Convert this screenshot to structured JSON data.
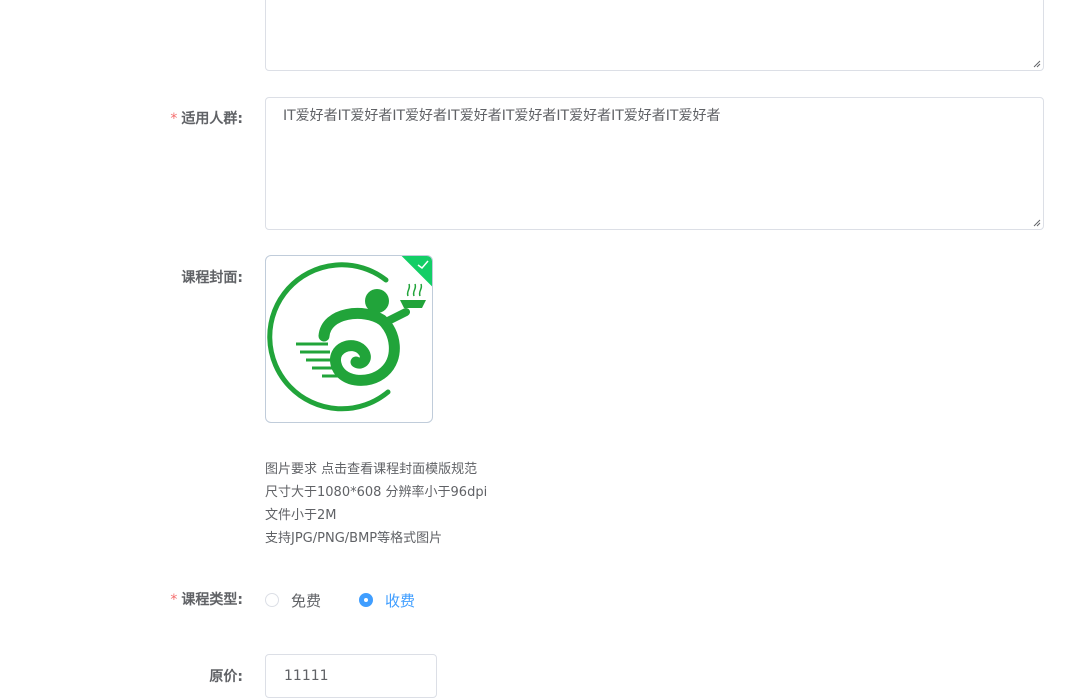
{
  "form": {
    "previous_textarea": {
      "value": ""
    },
    "audience": {
      "label": "适用人群:",
      "value": "IT爱好者IT爱好者IT爱好者IT爱好者IT爱好者IT爱好者IT爱好者IT爱好者"
    },
    "cover": {
      "label": "课程封面:",
      "image_icon": "green-brand-logo-icon",
      "status_icon": "check-icon",
      "hints": [
        "图片要求 点击查看课程封面模版规范",
        "尺寸大于1080*608 分辨率小于96dpi",
        "文件小于2M",
        "支持JPG/PNG/BMP等格式图片"
      ]
    },
    "course_type": {
      "label": "课程类型:",
      "options": [
        {
          "label": "免费",
          "checked": false
        },
        {
          "label": "收费",
          "checked": true
        }
      ]
    },
    "price": {
      "label": "原价:",
      "value": "11111"
    }
  },
  "colors": {
    "required_star": "#f56c6c",
    "primary": "#409eff",
    "success": "#13ce66",
    "logo_green": "#21a43a",
    "border": "#dcdfe6",
    "text": "#606266"
  }
}
